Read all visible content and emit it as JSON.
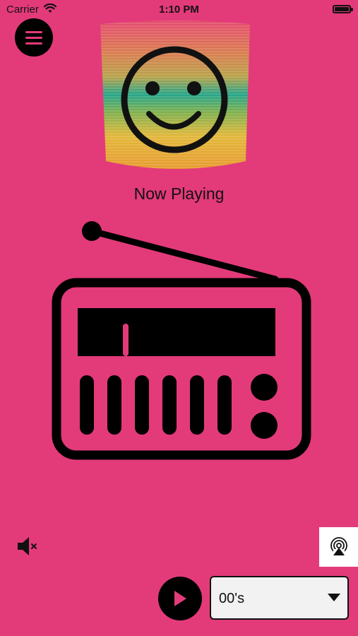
{
  "status_bar": {
    "carrier": "Carrier",
    "time": "1:10 PM"
  },
  "header": {
    "menu_icon": "hamburger-menu-icon"
  },
  "album_art": {
    "icon": "smiley-face-icon"
  },
  "now_playing": {
    "label": "Now Playing"
  },
  "main": {
    "radio_icon": "radio-icon"
  },
  "controls": {
    "mute_icon": "speaker-muted-icon",
    "airplay_icon": "airplay-icon",
    "play_icon": "play-icon",
    "station_select": {
      "value": "00's"
    }
  },
  "colors": {
    "background": "#E33A7A",
    "accent": "#000000"
  }
}
